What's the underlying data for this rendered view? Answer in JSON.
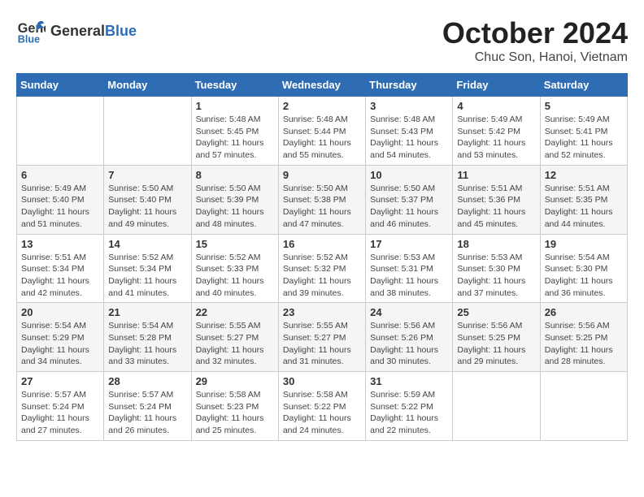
{
  "header": {
    "logo_general": "General",
    "logo_blue": "Blue",
    "month_title": "October 2024",
    "location": "Chuc Son, Hanoi, Vietnam"
  },
  "days_of_week": [
    "Sunday",
    "Monday",
    "Tuesday",
    "Wednesday",
    "Thursday",
    "Friday",
    "Saturday"
  ],
  "weeks": [
    [
      {
        "day": "",
        "info": ""
      },
      {
        "day": "",
        "info": ""
      },
      {
        "day": "1",
        "info": "Sunrise: 5:48 AM\nSunset: 5:45 PM\nDaylight: 11 hours and 57 minutes."
      },
      {
        "day": "2",
        "info": "Sunrise: 5:48 AM\nSunset: 5:44 PM\nDaylight: 11 hours and 55 minutes."
      },
      {
        "day": "3",
        "info": "Sunrise: 5:48 AM\nSunset: 5:43 PM\nDaylight: 11 hours and 54 minutes."
      },
      {
        "day": "4",
        "info": "Sunrise: 5:49 AM\nSunset: 5:42 PM\nDaylight: 11 hours and 53 minutes."
      },
      {
        "day": "5",
        "info": "Sunrise: 5:49 AM\nSunset: 5:41 PM\nDaylight: 11 hours and 52 minutes."
      }
    ],
    [
      {
        "day": "6",
        "info": "Sunrise: 5:49 AM\nSunset: 5:40 PM\nDaylight: 11 hours and 51 minutes."
      },
      {
        "day": "7",
        "info": "Sunrise: 5:50 AM\nSunset: 5:40 PM\nDaylight: 11 hours and 49 minutes."
      },
      {
        "day": "8",
        "info": "Sunrise: 5:50 AM\nSunset: 5:39 PM\nDaylight: 11 hours and 48 minutes."
      },
      {
        "day": "9",
        "info": "Sunrise: 5:50 AM\nSunset: 5:38 PM\nDaylight: 11 hours and 47 minutes."
      },
      {
        "day": "10",
        "info": "Sunrise: 5:50 AM\nSunset: 5:37 PM\nDaylight: 11 hours and 46 minutes."
      },
      {
        "day": "11",
        "info": "Sunrise: 5:51 AM\nSunset: 5:36 PM\nDaylight: 11 hours and 45 minutes."
      },
      {
        "day": "12",
        "info": "Sunrise: 5:51 AM\nSunset: 5:35 PM\nDaylight: 11 hours and 44 minutes."
      }
    ],
    [
      {
        "day": "13",
        "info": "Sunrise: 5:51 AM\nSunset: 5:34 PM\nDaylight: 11 hours and 42 minutes."
      },
      {
        "day": "14",
        "info": "Sunrise: 5:52 AM\nSunset: 5:34 PM\nDaylight: 11 hours and 41 minutes."
      },
      {
        "day": "15",
        "info": "Sunrise: 5:52 AM\nSunset: 5:33 PM\nDaylight: 11 hours and 40 minutes."
      },
      {
        "day": "16",
        "info": "Sunrise: 5:52 AM\nSunset: 5:32 PM\nDaylight: 11 hours and 39 minutes."
      },
      {
        "day": "17",
        "info": "Sunrise: 5:53 AM\nSunset: 5:31 PM\nDaylight: 11 hours and 38 minutes."
      },
      {
        "day": "18",
        "info": "Sunrise: 5:53 AM\nSunset: 5:30 PM\nDaylight: 11 hours and 37 minutes."
      },
      {
        "day": "19",
        "info": "Sunrise: 5:54 AM\nSunset: 5:30 PM\nDaylight: 11 hours and 36 minutes."
      }
    ],
    [
      {
        "day": "20",
        "info": "Sunrise: 5:54 AM\nSunset: 5:29 PM\nDaylight: 11 hours and 34 minutes."
      },
      {
        "day": "21",
        "info": "Sunrise: 5:54 AM\nSunset: 5:28 PM\nDaylight: 11 hours and 33 minutes."
      },
      {
        "day": "22",
        "info": "Sunrise: 5:55 AM\nSunset: 5:27 PM\nDaylight: 11 hours and 32 minutes."
      },
      {
        "day": "23",
        "info": "Sunrise: 5:55 AM\nSunset: 5:27 PM\nDaylight: 11 hours and 31 minutes."
      },
      {
        "day": "24",
        "info": "Sunrise: 5:56 AM\nSunset: 5:26 PM\nDaylight: 11 hours and 30 minutes."
      },
      {
        "day": "25",
        "info": "Sunrise: 5:56 AM\nSunset: 5:25 PM\nDaylight: 11 hours and 29 minutes."
      },
      {
        "day": "26",
        "info": "Sunrise: 5:56 AM\nSunset: 5:25 PM\nDaylight: 11 hours and 28 minutes."
      }
    ],
    [
      {
        "day": "27",
        "info": "Sunrise: 5:57 AM\nSunset: 5:24 PM\nDaylight: 11 hours and 27 minutes."
      },
      {
        "day": "28",
        "info": "Sunrise: 5:57 AM\nSunset: 5:24 PM\nDaylight: 11 hours and 26 minutes."
      },
      {
        "day": "29",
        "info": "Sunrise: 5:58 AM\nSunset: 5:23 PM\nDaylight: 11 hours and 25 minutes."
      },
      {
        "day": "30",
        "info": "Sunrise: 5:58 AM\nSunset: 5:22 PM\nDaylight: 11 hours and 24 minutes."
      },
      {
        "day": "31",
        "info": "Sunrise: 5:59 AM\nSunset: 5:22 PM\nDaylight: 11 hours and 22 minutes."
      },
      {
        "day": "",
        "info": ""
      },
      {
        "day": "",
        "info": ""
      }
    ]
  ]
}
